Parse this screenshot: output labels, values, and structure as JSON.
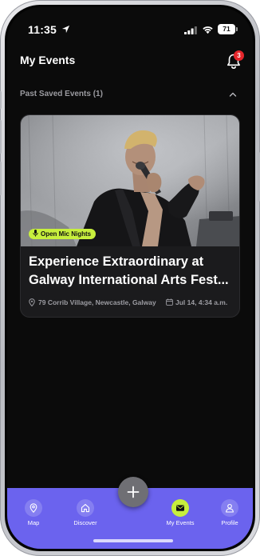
{
  "status_bar": {
    "time": "11:35",
    "battery": "71"
  },
  "header": {
    "title": "My Events",
    "notification_count": "3"
  },
  "section": {
    "label": "Past Saved Events (1)",
    "expanded": true
  },
  "event": {
    "category": "Open Mic Nights",
    "title_line1": "Experience Extraordinary at",
    "title_line2": "Galway International Arts Fest...",
    "location": "79 Corrib Village, Newcastle, Galway",
    "date": "Jul 14, 4:34 a.m."
  },
  "nav": {
    "items": [
      {
        "label": "Map",
        "icon": "map-pin-icon"
      },
      {
        "label": "Discover",
        "icon": "home-icon"
      },
      {
        "label": "My Events",
        "icon": "envelope-icon",
        "active": true
      },
      {
        "label": "Profile",
        "icon": "person-icon"
      }
    ],
    "fab_icon": "plus-icon"
  },
  "colors": {
    "accent": "#c7ef3d",
    "nav_bg": "#6b63ee",
    "badge": "#e5262b",
    "background": "#0b0b0b"
  }
}
